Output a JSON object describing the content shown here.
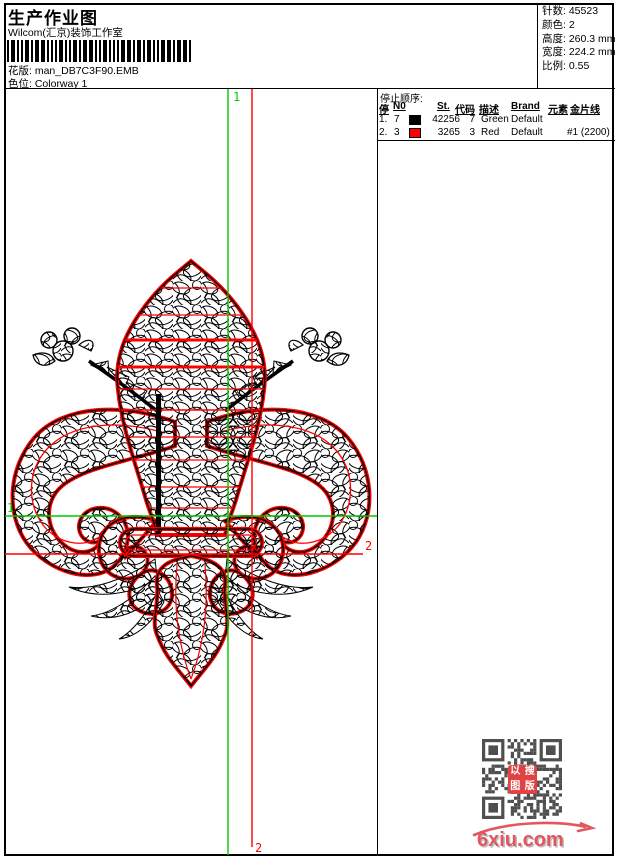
{
  "header": {
    "title": "生产作业图",
    "subtitle": "Wilcom(汇京)装饰工作室",
    "pattern_label": "花版:",
    "pattern_value": "man_DB7C3F90.EMB",
    "colorway_label": "色位:",
    "colorway_value": "Colorway 1"
  },
  "info": {
    "stitches_label": "针数:",
    "stitches_value": "45523",
    "colors_label": "颜色:",
    "colors_value": "2",
    "height_label": "高度:",
    "height_value": "260.3 mm",
    "width_label": "宽度:",
    "width_value": "224.2 mm",
    "scale_label": "比例:",
    "scale_value": "0.55"
  },
  "stop_table": {
    "caption": "停止顺序:",
    "headers": {
      "stop": "停",
      "needle": "N0",
      "st": "St.",
      "code": "代码",
      "desc": "描述",
      "brand": "Brand",
      "element": "元素",
      "sequin": "金片线"
    },
    "rows": [
      {
        "stop": "1.",
        "needle": "7",
        "swatch": "#000000",
        "st": "42256",
        "code": "7",
        "desc": "Green",
        "brand": "Default",
        "element": "",
        "sequin": ""
      },
      {
        "stop": "2.",
        "needle": "3",
        "swatch": "#ff0000",
        "st": "3265",
        "code": "3",
        "desc": "Red",
        "brand": "Default",
        "element": "",
        "sequin": "#1 (2200)"
      }
    ]
  },
  "design": {
    "marker_start": "1",
    "marker_end": "2",
    "guide_green": "#00c800",
    "guide_red": "#ff0000",
    "outline_red": "#ff0000",
    "stitch_black": "#000000"
  },
  "barcode": {
    "pattern": "1211212211121121221121112212121122122111212112"
  },
  "qr": {
    "color": "#4f4f4f",
    "logo_chars": [
      "以",
      "搜",
      "图",
      "版"
    ],
    "logo_color": "#e04343"
  },
  "watermark": {
    "text": "6xiu.com",
    "color": "#e2575f"
  }
}
